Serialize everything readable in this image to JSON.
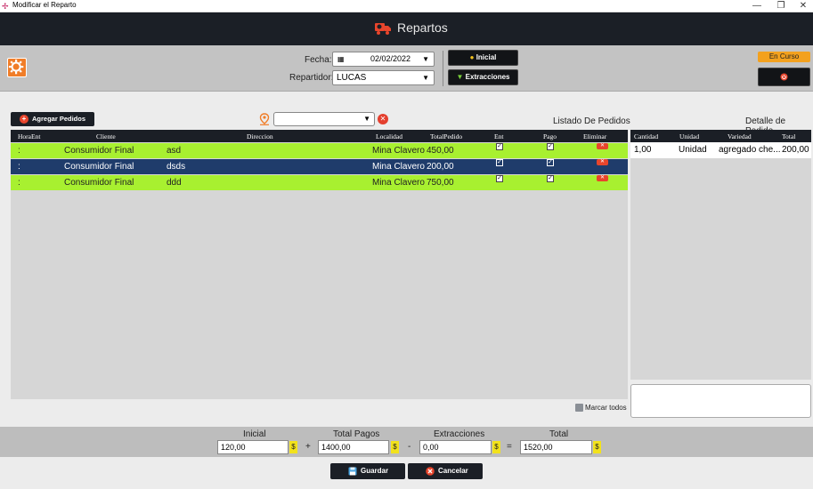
{
  "window": {
    "title": "Modificar el Reparto",
    "controls": [
      "—",
      "❐",
      "✕"
    ]
  },
  "header": {
    "title": "Repartos"
  },
  "filters": {
    "fecha_label": "Fecha:",
    "fecha_value": "02/02/2022",
    "repartidor_label": "Repartidor:",
    "repartidor_value": "LUCAS"
  },
  "actions": {
    "inicial_label": "Inicial",
    "extracciones_label": "Extracciones"
  },
  "status": {
    "badge": "En Curso"
  },
  "orders": {
    "add_button": "Agregar Pedidos",
    "section_title": "Listado De Pedidos",
    "columns": [
      "HoraEnt",
      "Cliente",
      "Direccion",
      "Localidad",
      "TotalPedido",
      "Ent",
      "Pago",
      "Eliminar"
    ],
    "rows": [
      {
        "hora": ":",
        "cliente": "Consumidor Final",
        "direccion": "asd",
        "localidad": "Mina Clavero",
        "total": "450,00",
        "ent": true,
        "pago": true
      },
      {
        "hora": ":",
        "cliente": "Consumidor Final",
        "direccion": "dsds",
        "localidad": "Mina Clavero",
        "total": "200,00",
        "ent": true,
        "pago": true
      },
      {
        "hora": ":",
        "cliente": "Consumidor Final",
        "direccion": "ddd",
        "localidad": "Mina Clavero",
        "total": "750,00",
        "ent": true,
        "pago": true
      }
    ],
    "marcar_todos": "Marcar todos"
  },
  "detail": {
    "section_title": "Detalle de Pedido",
    "columns": [
      "Cantidad",
      "Unidad",
      "Variedad",
      "Total"
    ],
    "rows": [
      {
        "cantidad": "1,00",
        "unidad": "Unidad",
        "variedad": "agregado che...",
        "total": "200,00"
      }
    ]
  },
  "totals": {
    "inicial_label": "Inicial",
    "inicial_value": "120,00",
    "pagos_label": "Total Pagos",
    "pagos_value": "1400,00",
    "extracciones_label": "Extracciones",
    "extracciones_value": "0,00",
    "total_label": "Total",
    "total_value": "1520,00",
    "currency": "$",
    "op_plus": "+",
    "op_minus": "-",
    "op_equals": "="
  },
  "footer": {
    "guardar_label": "Guardar",
    "cancelar_label": "Cancelar"
  },
  "colors": {
    "header": "#1b1f26",
    "row_green": "#a8f030",
    "row_selected": "#1f3c6b",
    "accent_orange": "#f07d28",
    "badge": "#f3a11e",
    "danger": "#e8452c"
  }
}
